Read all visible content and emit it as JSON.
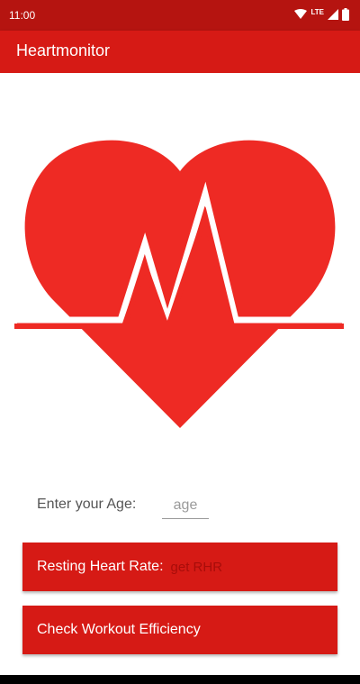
{
  "status_bar": {
    "time": "11:00",
    "network": "LTE",
    "icons": [
      "wifi-icon",
      "signal-icon",
      "battery-icon"
    ]
  },
  "app_bar": {
    "title": "Heartmonitor"
  },
  "hero": {
    "icon": "heart-ecg-icon"
  },
  "age": {
    "label": "Enter your Age:",
    "placeholder": "age",
    "value": ""
  },
  "resting_heart_rate": {
    "label": "Resting Heart Rate:",
    "placeholder": "get RHR",
    "value": ""
  },
  "workout": {
    "label": "Check Workout Efficiency"
  },
  "colors": {
    "primary": "#d61a15",
    "primary_dark": "#b51410",
    "heart": "#ee2a24",
    "background": "#ffffff"
  }
}
